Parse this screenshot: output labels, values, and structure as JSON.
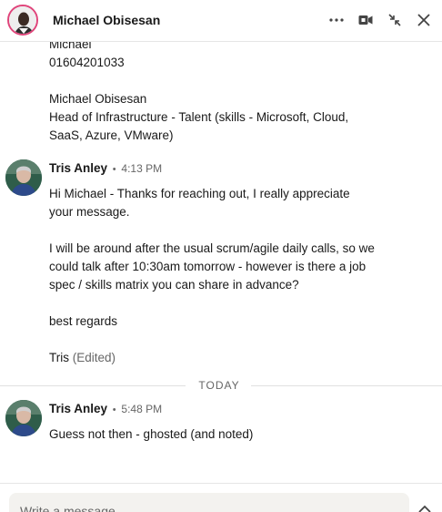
{
  "header": {
    "contact_name": "Michael Obisesan",
    "icons": [
      "more-icon",
      "video-call-icon",
      "minimize-icon",
      "close-icon"
    ],
    "accent_color": "#e0457b"
  },
  "messages": {
    "earlier_signature": {
      "lines": [
        "Michael",
        "01604201033",
        "",
        "Michael Obisesan",
        "Head of Infrastructure - Talent (skills - Microsoft, Cloud,",
        "SaaS, Azure, VMware)"
      ]
    },
    "reply_1": {
      "sender": "Tris Anley",
      "dot": "•",
      "time": "4:13 PM",
      "lines": [
        "Hi Michael - Thanks for reaching out, I really appreciate",
        "your message.",
        "",
        "I will be around after the usual scrum/agile daily calls, so we",
        "could talk after 10:30am tomorrow - however is there a job",
        "spec / skills matrix you can share in advance?",
        "",
        "best regards",
        ""
      ],
      "signoff": "Tris",
      "edited_label": "(Edited)"
    },
    "divider_label": "TODAY",
    "reply_2": {
      "sender": "Tris Anley",
      "dot": "•",
      "time": "5:48 PM",
      "text": "Guess not then - ghosted (and noted)"
    }
  },
  "composer": {
    "placeholder": "Write a message..."
  }
}
